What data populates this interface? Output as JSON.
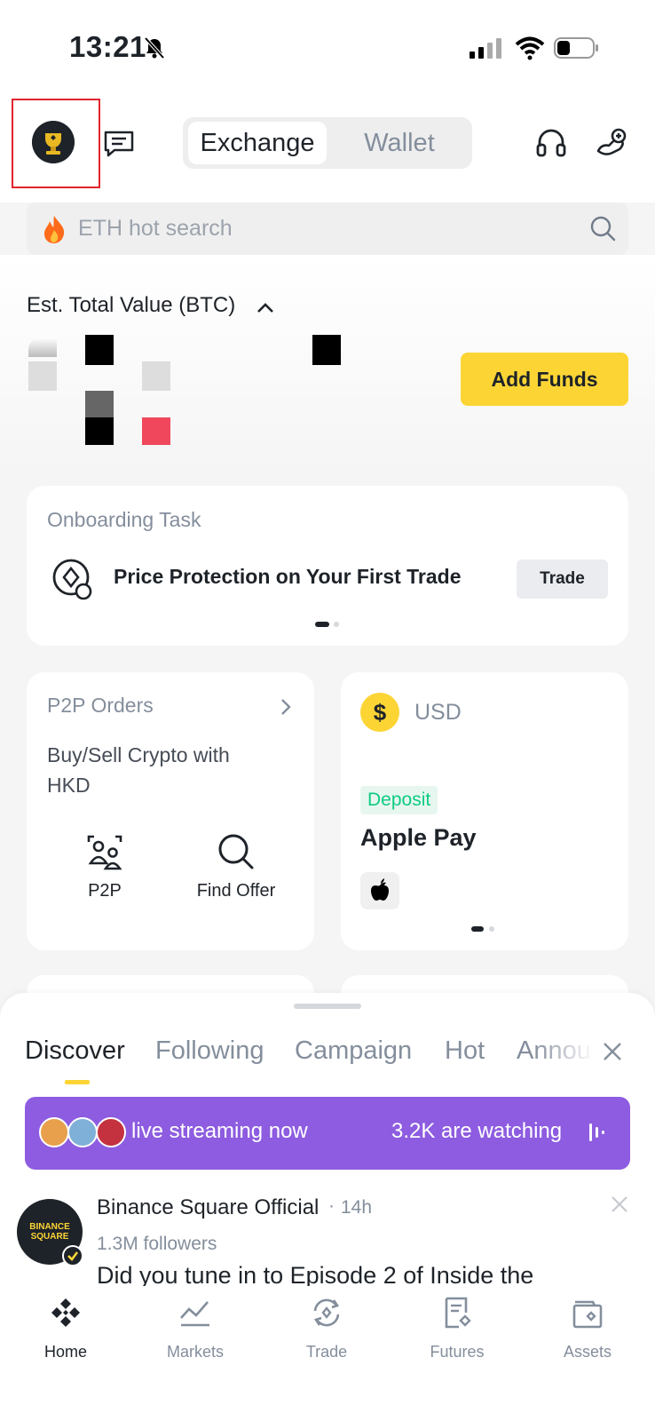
{
  "status_bar": {
    "time": "13:21"
  },
  "header": {
    "segment": {
      "exchange": "Exchange",
      "wallet": "Wallet"
    }
  },
  "search": {
    "placeholder": "ETH hot search"
  },
  "balance": {
    "label": "Est. Total Value (BTC)",
    "add_funds": "Add Funds"
  },
  "onboarding": {
    "title": "Onboarding Task",
    "task": "Price Protection on Your First Trade",
    "button": "Trade"
  },
  "p2p": {
    "title": "P2P Orders",
    "subtitle": "Buy/Sell Crypto with HKD",
    "actions": [
      {
        "label": "P2P",
        "icon": "p2p-people-icon"
      },
      {
        "label": "Find Offer",
        "icon": "search-icon"
      }
    ]
  },
  "usd": {
    "currency": "USD",
    "coin_symbol": "$",
    "badge": "Deposit",
    "method": "Apple Pay"
  },
  "feed": {
    "tabs": [
      "Discover",
      "Following",
      "Campaign",
      "Hot",
      "Annou"
    ],
    "live": {
      "text": "live streaming now",
      "watching": "3.2K are watching"
    },
    "post": {
      "author": "Binance Square Official",
      "time": "14h",
      "followers": "1.3M followers",
      "body": "Did you tune in to Episode 2 of Inside the",
      "avatar_text": "BINANCE SQUARE"
    }
  },
  "nav": [
    {
      "label": "Home",
      "icon": "home-icon",
      "active": true
    },
    {
      "label": "Markets",
      "icon": "markets-icon",
      "active": false
    },
    {
      "label": "Trade",
      "icon": "trade-icon",
      "active": false
    },
    {
      "label": "Futures",
      "icon": "futures-icon",
      "active": false
    },
    {
      "label": "Assets",
      "icon": "assets-icon",
      "active": false
    }
  ],
  "colors": {
    "accent": "#fcd535",
    "live_banner": "#8d5ce0",
    "deposit_green": "#0ecb81",
    "highlight_border": "#e0242e"
  }
}
